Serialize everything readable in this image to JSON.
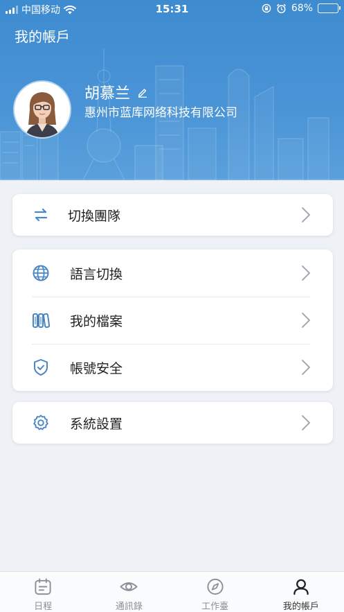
{
  "status_bar": {
    "carrier": "中国移动",
    "time": "15:31",
    "battery": "68%",
    "battery_level": 0.68
  },
  "header": {
    "title": "我的帳戶",
    "user_name": "胡慕兰",
    "company": "惠州市蓝库网络科技有限公司"
  },
  "menu": {
    "switch_team": "切換團隊",
    "language": "語言切換",
    "my_files": "我的檔案",
    "account_security": "帳號安全",
    "system_settings": "系統設置"
  },
  "tabs": [
    {
      "label": "日程",
      "icon": "calendar-icon"
    },
    {
      "label": "通訊錄",
      "icon": "eye-icon"
    },
    {
      "label": "工作臺",
      "icon": "compass-icon"
    },
    {
      "label": "我的帳戶",
      "icon": "user-icon"
    }
  ],
  "colors": {
    "header_blue": "#4a94d6",
    "icon_blue": "#4a86c5",
    "background": "#eef1f5"
  }
}
